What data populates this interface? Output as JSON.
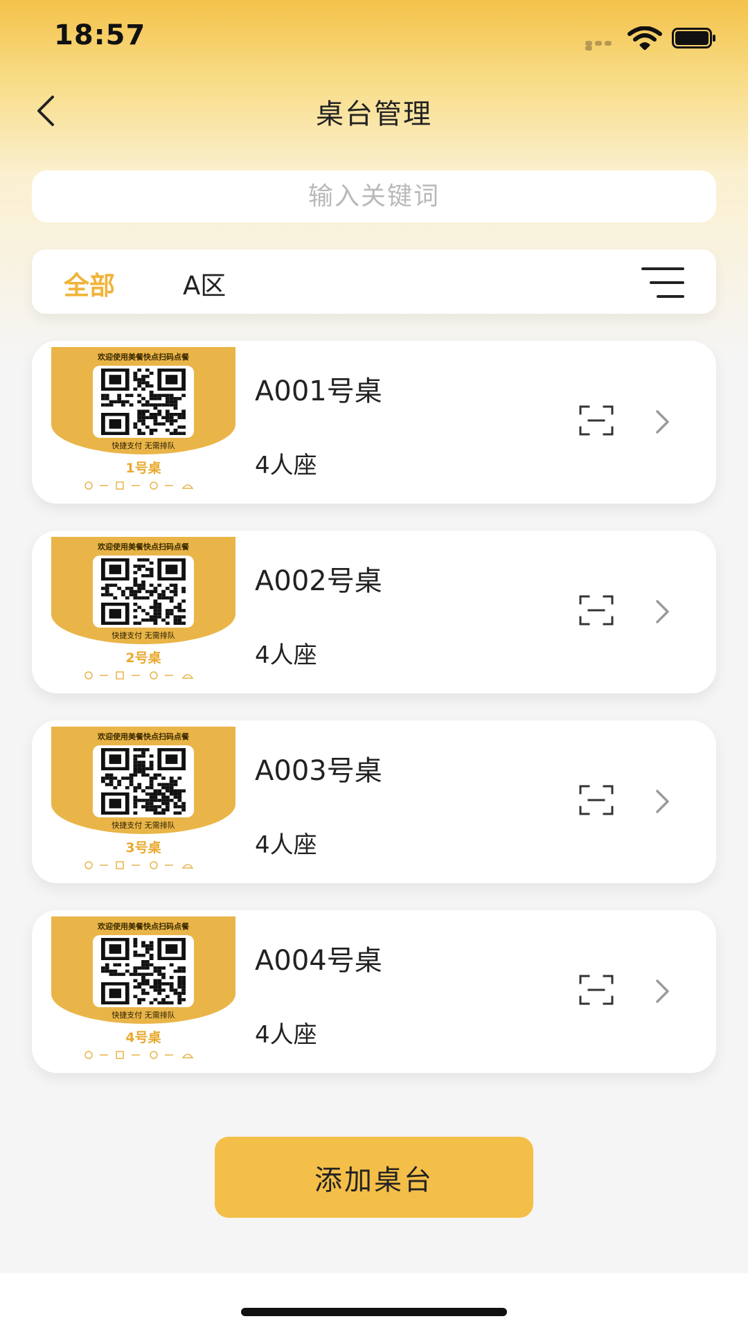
{
  "status": {
    "time": "18:57"
  },
  "nav": {
    "title": "桌台管理"
  },
  "search": {
    "placeholder": "输入关键词"
  },
  "filters": {
    "tabs": [
      {
        "label": "全部",
        "active": true
      },
      {
        "label": "A区",
        "active": false
      }
    ]
  },
  "qr_template": {
    "header": "欢迎使用美餐快点扫码点餐",
    "sub": "快捷支付  无需排队"
  },
  "tables": [
    {
      "name": "A001号桌",
      "seats": "4人座",
      "qr_label": "1号桌"
    },
    {
      "name": "A002号桌",
      "seats": "4人座",
      "qr_label": "2号桌"
    },
    {
      "name": "A003号桌",
      "seats": "4人座",
      "qr_label": "3号桌"
    },
    {
      "name": "A004号桌",
      "seats": "4人座",
      "qr_label": "4号桌"
    }
  ],
  "actions": {
    "add_label": "添加桌台"
  },
  "colors": {
    "accent": "#f4bf48",
    "active_tab": "#f0b43b",
    "qr_gold": "#eab548"
  }
}
